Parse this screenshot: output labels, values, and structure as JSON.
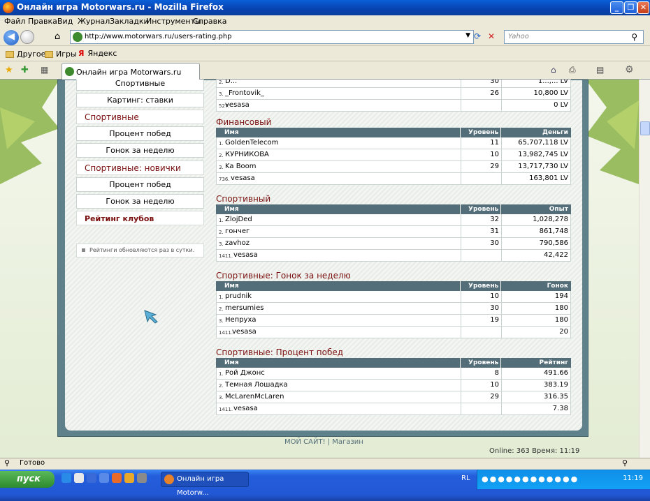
{
  "window": {
    "title": "Онлайн игра Motorwars.ru - Mozilla Firefox"
  },
  "menu": [
    "Файл",
    "Правка",
    "Вид",
    "Журнал",
    "Закладки",
    "Инструменты",
    "Справка"
  ],
  "nav": {
    "url": "http://www.motorwars.ru/users-rating.php",
    "search_placeholder": "Yahoo"
  },
  "bookmarks": [
    "Другое",
    "Игры",
    "Яндекс"
  ],
  "tab": {
    "label": "Онлайн игра Motorwars.ru"
  },
  "sidebar": {
    "items": [
      {
        "label": "Спортивные",
        "kind": "btn"
      },
      {
        "label": "Картинг: ставки",
        "kind": "btn"
      },
      {
        "label": "Спортивные",
        "kind": "head"
      },
      {
        "label": "Процент побед",
        "kind": "btn"
      },
      {
        "label": "Гонок за неделю",
        "kind": "btn"
      },
      {
        "label": "Спортивные: новички",
        "kind": "head"
      },
      {
        "label": "Процент побед",
        "kind": "btn"
      },
      {
        "label": "Гонок за неделю",
        "kind": "btn"
      },
      {
        "label": "Рейтинг клубов",
        "kind": "head-bold"
      }
    ],
    "note": "Рейтинги обновляются раз в сутки."
  },
  "top_partial": {
    "rows": [
      {
        "rank": "2.",
        "name": "D...",
        "level": "30",
        "value": "1...,... LV"
      },
      {
        "rank": "3.",
        "name": "_Frontovik_",
        "level": "26",
        "value": "10,800 LV"
      },
      {
        "rank": "527.",
        "name": "vesasa",
        "level": "",
        "value": "0 LV"
      }
    ]
  },
  "tables": [
    {
      "title": "Финансовый",
      "cols": [
        "Имя",
        "Уровень",
        "Деньги"
      ],
      "rows": [
        {
          "rank": "1.",
          "name": "GoldenTelecom",
          "level": "11",
          "value": "65,707,118 LV"
        },
        {
          "rank": "2.",
          "name": "КУРНИКОВА",
          "level": "10",
          "value": "13,982,745 LV"
        },
        {
          "rank": "3.",
          "name": "Ka Boom",
          "level": "29",
          "value": "13,717,730 LV"
        },
        {
          "rank": "736.",
          "name": "vesasa",
          "level": "",
          "value": "163,801 LV"
        }
      ]
    },
    {
      "title": "Спортивный",
      "cols": [
        "Имя",
        "Уровень",
        "Опыт"
      ],
      "rows": [
        {
          "rank": "1.",
          "name": "ZlojDed",
          "level": "32",
          "value": "1,028,278"
        },
        {
          "rank": "2.",
          "name": "гончег",
          "level": "31",
          "value": "861,748"
        },
        {
          "rank": "3.",
          "name": "zavhoz",
          "level": "30",
          "value": "790,586"
        },
        {
          "rank": "1411.",
          "name": "vesasa",
          "level": "",
          "value": "42,422"
        }
      ]
    },
    {
      "title": "Спортивные: Гонок за неделю",
      "cols": [
        "Имя",
        "Уровень",
        "Гонок"
      ],
      "rows": [
        {
          "rank": "1.",
          "name": "prudnik",
          "level": "10",
          "value": "194"
        },
        {
          "rank": "2.",
          "name": "mersumies",
          "level": "30",
          "value": "180"
        },
        {
          "rank": "3.",
          "name": "Непруха",
          "level": "19",
          "value": "180"
        },
        {
          "rank": "1411.",
          "name": "vesasa",
          "level": "",
          "value": "20"
        }
      ]
    },
    {
      "title": "Спортивные: Процент побед",
      "cols": [
        "Имя",
        "Уровень",
        "Рейтинг"
      ],
      "rows": [
        {
          "rank": "1.",
          "name": "Рой Джонс",
          "level": "8",
          "value": "491.66"
        },
        {
          "rank": "2.",
          "name": "Темная Лошадка",
          "level": "10",
          "value": "383.19"
        },
        {
          "rank": "3.",
          "name": "McLarenMcLaren",
          "level": "29",
          "value": "316.35"
        },
        {
          "rank": "1411.",
          "name": "vesasa",
          "level": "",
          "value": "7.38"
        }
      ]
    }
  ],
  "footer": {
    "links": "МОЙ САЙТ! | Магазин",
    "online": "Online: 363   Время: 11:19"
  },
  "status": {
    "text": "Готово"
  },
  "taskbar": {
    "start": "пуск",
    "item": "Онлайн игра Motorw...",
    "lang": "RL",
    "time": "11:19"
  }
}
